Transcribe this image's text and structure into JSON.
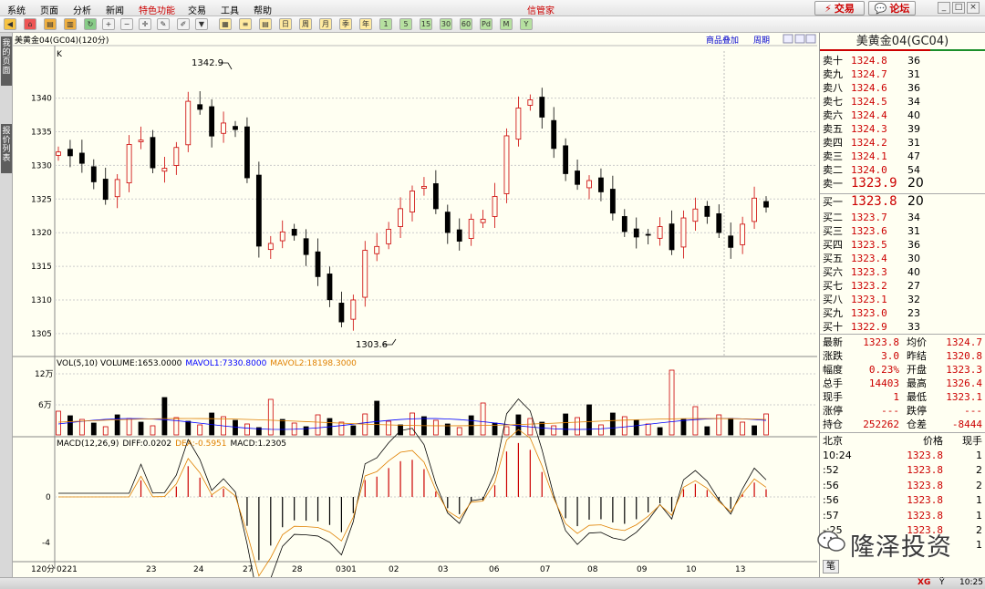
{
  "menubar": {
    "items": [
      "系统",
      "页面",
      "分析",
      "新闻",
      "特色功能",
      "交易",
      "工具",
      "帮助"
    ],
    "highlight_index": 4,
    "app_title": "信管家",
    "trade_button": "交易",
    "forum_button": "论坛"
  },
  "toolbar": {
    "buttons": [
      "1",
      "5",
      "15",
      "30",
      "60",
      "日",
      "周",
      "月",
      "季",
      "年",
      "1",
      "5",
      "15",
      "30",
      "60",
      "Pd",
      "M",
      "Y"
    ]
  },
  "sidebar": {
    "tabs": [
      "我的页面",
      "报价列表"
    ]
  },
  "chart": {
    "header": "美黄金04(GC04)(120分)",
    "overlay_link": "商品叠加",
    "period_link": "周期",
    "k_label": "K",
    "vol_legend": {
      "vol": "VOL(5,10) VOLUME:1653.0000",
      "mavol1": "MAVOL1:7330.8000",
      "mavol2": "MAVOL2:18198.3000"
    },
    "macd_legend": {
      "macd": "MACD(12,26,9)",
      "diff": "DIFF:0.0202",
      "dea": "DEA:-0.5951",
      "macd_val": "MACD:1.2305"
    },
    "period_label": "120分",
    "high_label": "1342.9",
    "low_label": "1303.6"
  },
  "chart_data": {
    "type": "candlestick",
    "title": "美黄金04(GC04)(120分)",
    "price_axis": {
      "ylim": [
        1302,
        1347
      ],
      "ticks": [
        1305,
        1310,
        1315,
        1320,
        1325,
        1330,
        1335,
        1340
      ]
    },
    "volume_axis": {
      "ticks": [
        "6万",
        "12万"
      ]
    },
    "macd_axis": {
      "ticks": [
        "0",
        "-4"
      ]
    },
    "x_date_labels": [
      "0221",
      "23",
      "24",
      "27",
      "28",
      "0301",
      "02",
      "03",
      "06",
      "07",
      "08",
      "09",
      "10",
      "13"
    ],
    "high": 1342.9,
    "low": 1303.6,
    "last": 1323.8
  },
  "quote": {
    "title": "美黄金04(GC04)",
    "asks": [
      {
        "label": "卖十",
        "price": "1324.8",
        "vol": "36"
      },
      {
        "label": "卖九",
        "price": "1324.7",
        "vol": "31"
      },
      {
        "label": "卖八",
        "price": "1324.6",
        "vol": "36"
      },
      {
        "label": "卖七",
        "price": "1324.5",
        "vol": "34"
      },
      {
        "label": "卖六",
        "price": "1324.4",
        "vol": "40"
      },
      {
        "label": "卖五",
        "price": "1324.3",
        "vol": "39"
      },
      {
        "label": "卖四",
        "price": "1324.2",
        "vol": "31"
      },
      {
        "label": "卖三",
        "price": "1324.1",
        "vol": "47"
      },
      {
        "label": "卖二",
        "price": "1324.0",
        "vol": "54"
      },
      {
        "label": "卖一",
        "price": "1323.9",
        "vol": "20"
      }
    ],
    "bids": [
      {
        "label": "买一",
        "price": "1323.8",
        "vol": "20"
      },
      {
        "label": "买二",
        "price": "1323.7",
        "vol": "34"
      },
      {
        "label": "买三",
        "price": "1323.6",
        "vol": "31"
      },
      {
        "label": "买四",
        "price": "1323.5",
        "vol": "36"
      },
      {
        "label": "买五",
        "price": "1323.4",
        "vol": "30"
      },
      {
        "label": "买六",
        "price": "1323.3",
        "vol": "40"
      },
      {
        "label": "买七",
        "price": "1323.2",
        "vol": "27"
      },
      {
        "label": "买八",
        "price": "1323.1",
        "vol": "32"
      },
      {
        "label": "买九",
        "price": "1323.0",
        "vol": "23"
      },
      {
        "label": "买十",
        "price": "1322.9",
        "vol": "33"
      }
    ],
    "stats": [
      {
        "l1": "最新",
        "v1": "1323.8",
        "l2": "均价",
        "v2": "1324.7"
      },
      {
        "l1": "涨跌",
        "v1": "3.0",
        "l2": "昨结",
        "v2": "1320.8"
      },
      {
        "l1": "幅度",
        "v1": "0.23%",
        "l2": "开盘",
        "v2": "1323.3"
      },
      {
        "l1": "总手",
        "v1": "14403",
        "l2": "最高",
        "v2": "1326.4"
      },
      {
        "l1": "现手",
        "v1": "1",
        "l2": "最低",
        "v2": "1323.1"
      },
      {
        "l1": "涨停",
        "v1": "---",
        "l2": "跌停",
        "v2": "---"
      },
      {
        "l1": "持仓",
        "v1": "252262",
        "l2": "仓差",
        "v2": "-8444"
      }
    ],
    "ticks_header": {
      "time": "北京",
      "price": "价格",
      "vol": "现手"
    },
    "ticks": [
      {
        "time": "10:24",
        "price": "1323.8",
        "vol": "1"
      },
      {
        "time": ":52",
        "price": "1323.8",
        "vol": "2"
      },
      {
        "time": ":56",
        "price": "1323.8",
        "vol": "2"
      },
      {
        "time": ":56",
        "price": "1323.8",
        "vol": "1"
      },
      {
        "time": ":57",
        "price": "1323.8",
        "vol": "1"
      },
      {
        "time": "-:25",
        "price": "1323.8",
        "vol": "2"
      },
      {
        "time": "",
        "price": "",
        "vol": "1"
      }
    ],
    "bottom_tab": "笔"
  },
  "status": {
    "time": "10:25",
    "signal": "XG"
  },
  "watermark": "隆泽投资"
}
